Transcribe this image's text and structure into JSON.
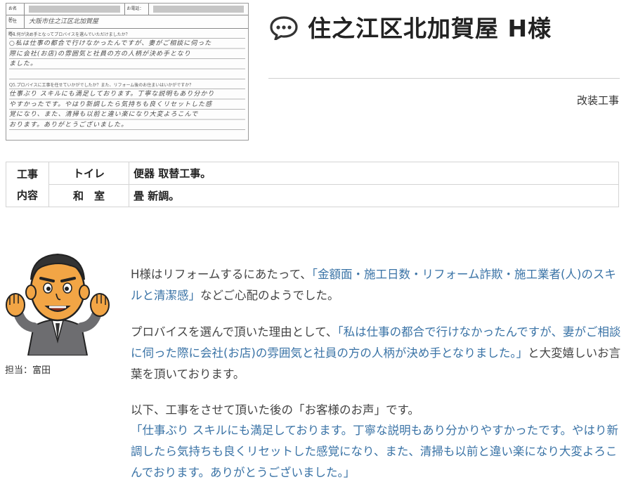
{
  "survey": {
    "name_label": "お名前：",
    "phone_label": "お電話：",
    "address_label": "ご住所：",
    "address_handwriting": "大阪市住之江区北加賀屋",
    "q4": "Q4.何が決め手となってプロバイスを選んでいただけましたか？",
    "q4_lines": [
      "○私は仕事の都合で行けなかったんですが、妻がご相談に伺った",
      "際に会社(お店)の雰囲気と社員の方の人柄が決め手となり",
      "ました。",
      ""
    ],
    "q5": "Q5.プロバイスに工事を任せていかがでしたか？また、リフォーム後のお住まいはいかがですか？",
    "q5_lines": [
      "仕事ぶり スキルにも満足しております。丁寧な説明もあり分かり",
      "やすかったです。やはり新調したら気持ちも良くリセットした感",
      "覚になり、また、清掃も以前と違い楽になり大変よろこんで",
      "おります。ありがとうございました。"
    ]
  },
  "header": {
    "icon": "speech-bubble-icon",
    "title": "住之江区北加賀屋 H様",
    "category": "改装工事"
  },
  "work_table": {
    "header_line1": "工事",
    "header_line2": "内容",
    "rows": [
      {
        "room": "トイレ",
        "desc": "便器 取替工事。"
      },
      {
        "room": "和　室",
        "desc": "畳 新調。"
      }
    ]
  },
  "staff": {
    "label": "担当：富田",
    "avatar_icon": "staff-mascot-icon"
  },
  "message": {
    "p1_pre": "H様はリフォームするにあたって、",
    "p1_hl": "「金額面・施工日数・リフォーム詐欺・施工業者(人)のスキルと清潔感」",
    "p1_post": "などご心配のようでした。",
    "p2_pre": "プロバイスを選んで頂いた理由として、",
    "p2_hl": "「私は仕事の都合で行けなかったんですが、妻がご相談に伺った際に会社(お店)の雰囲気と社員の方の人柄が決め手となりました。」",
    "p2_post": "と大変嬉しいお言葉を頂いております。",
    "p3_intro": "以下、工事をさせて頂いた後の「お客様のお声」です。",
    "p3_voice": "「仕事ぶり スキルにも満足しております。丁寧な説明もあり分かりやすかったです。やはり新調したら気持ちも良くリセットした感覚になり、また、清掃も以前と違い楽になり大変よろこんでおります。ありがとうございました。」"
  },
  "colors": {
    "accent_blue": "#3a73a6",
    "text": "#444444",
    "border": "#d4d4d4"
  }
}
